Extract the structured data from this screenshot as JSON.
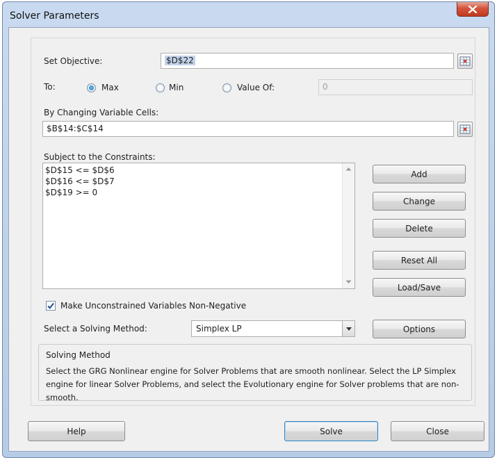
{
  "window": {
    "title": "Solver Parameters"
  },
  "objective": {
    "label": "Set Objective:",
    "value": "$D$22"
  },
  "to": {
    "label": "To:",
    "max_label": "Max",
    "min_label": "Min",
    "valueof_label": "Value Of:",
    "valueof_value": "0",
    "selected": "Max"
  },
  "changing": {
    "label": "By Changing Variable Cells:",
    "value": "$B$14:$C$14"
  },
  "constraints": {
    "label": "Subject to the Constraints:",
    "items": [
      "$D$15 <= $D$6",
      "$D$16 <= $D$7",
      "$D$19 >= 0"
    ]
  },
  "buttons": {
    "add": "Add",
    "change": "Change",
    "delete": "Delete",
    "reset_all": "Reset All",
    "load_save": "Load/Save",
    "options": "Options",
    "help": "Help",
    "solve": "Solve",
    "close": "Close"
  },
  "nonneg": {
    "label": "Make Unconstrained Variables Non-Negative",
    "checked": true
  },
  "method": {
    "label": "Select a Solving Method:",
    "value": "Simplex LP"
  },
  "solving_method": {
    "title": "Solving Method",
    "description": "Select the GRG Nonlinear engine for Solver Problems that are smooth nonlinear. Select the LP Simplex engine for linear Solver Problems, and select the Evolutionary engine for Solver problems that are non-smooth."
  },
  "icons": {
    "close": "close-icon",
    "range_picker": "range-picker-icon",
    "scroll_up": "scroll-up-arrow-icon",
    "scroll_down": "scroll-down-arrow-icon",
    "dropdown": "dropdown-arrow-icon",
    "check": "checkmark-icon"
  },
  "colors": {
    "title_bar": "#b6cbe6",
    "close_button": "#c94a30",
    "client": "#f0f0f0",
    "selection": "#c3d3ea"
  }
}
